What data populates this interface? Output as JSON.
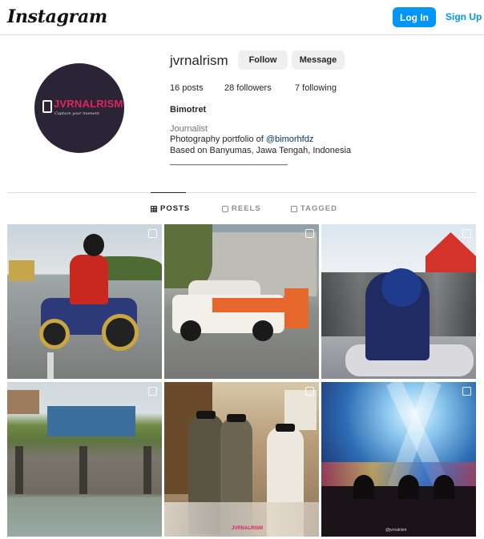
{
  "app": {
    "logo": "Instagram",
    "login_label": "Log In",
    "signup_label": "Sign Up",
    "accent_color": "#0095f6"
  },
  "profile": {
    "username": "jvrnalrism",
    "follow_label": "Follow",
    "message_label": "Message",
    "stats": {
      "posts": "16 posts",
      "followers": "28 followers",
      "following": "7 following"
    },
    "full_name": "Bimotret",
    "category": "Journalist",
    "bio_line1_prefix": "Photography portfolio of ",
    "bio_mention": "@bimorhfdz",
    "bio_line2": "Based on Banyumas, Jawa Tengah, Indonesia",
    "bio_line3": "________________________",
    "avatar": {
      "brand_text": "JVRNALRISM",
      "tagline": "Capture your moment",
      "icon": "camera-icon"
    }
  },
  "tabs": [
    {
      "label": "POSTS",
      "icon": "grid-icon",
      "active": true
    },
    {
      "label": "REELS",
      "icon": "reels-icon",
      "active": false
    },
    {
      "label": "TAGGED",
      "icon": "tag-icon",
      "active": false
    }
  ],
  "posts": [
    {
      "subject": "motorcycle rider on road",
      "multi": true
    },
    {
      "subject": "white and orange car with open door",
      "multi": true
    },
    {
      "subject": "motorcycle rider with helmet in crowd",
      "multi": true
    },
    {
      "subject": "river dam with gates",
      "multi": true
    },
    {
      "subject": "men in traditional clothing indoors",
      "multi": true
    },
    {
      "subject": "concert stage lights with audience",
      "multi": true
    }
  ],
  "post_overlays": {
    "post5_brand": "JVRNALRISM",
    "post6_watermark": "@jvrnalrism"
  }
}
